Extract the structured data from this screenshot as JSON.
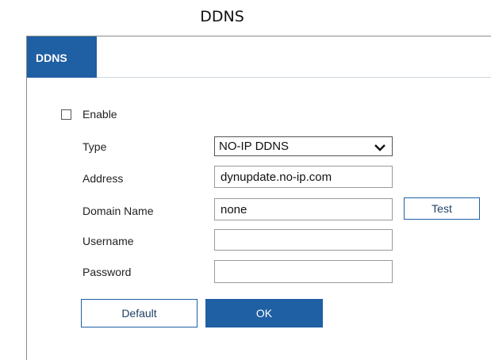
{
  "page": {
    "title": "DDNS"
  },
  "tabs": [
    {
      "label": "DDNS",
      "active": true
    }
  ],
  "form": {
    "enable": {
      "label": "Enable",
      "checked": false
    },
    "type": {
      "label": "Type",
      "value": "NO-IP DDNS"
    },
    "address": {
      "label": "Address",
      "value": "dynupdate.no-ip.com"
    },
    "domain_name": {
      "label": "Domain Name",
      "value": "none"
    },
    "username": {
      "label": "Username",
      "value": ""
    },
    "password": {
      "label": "Password",
      "value": ""
    }
  },
  "buttons": {
    "test": "Test",
    "default": "Default",
    "ok": "OK"
  },
  "colors": {
    "accent": "#1f5fa3",
    "border": "#9a9a9a"
  },
  "icons": {
    "select_arrow": "chevron-down-icon",
    "checkbox": "checkbox-unchecked"
  }
}
